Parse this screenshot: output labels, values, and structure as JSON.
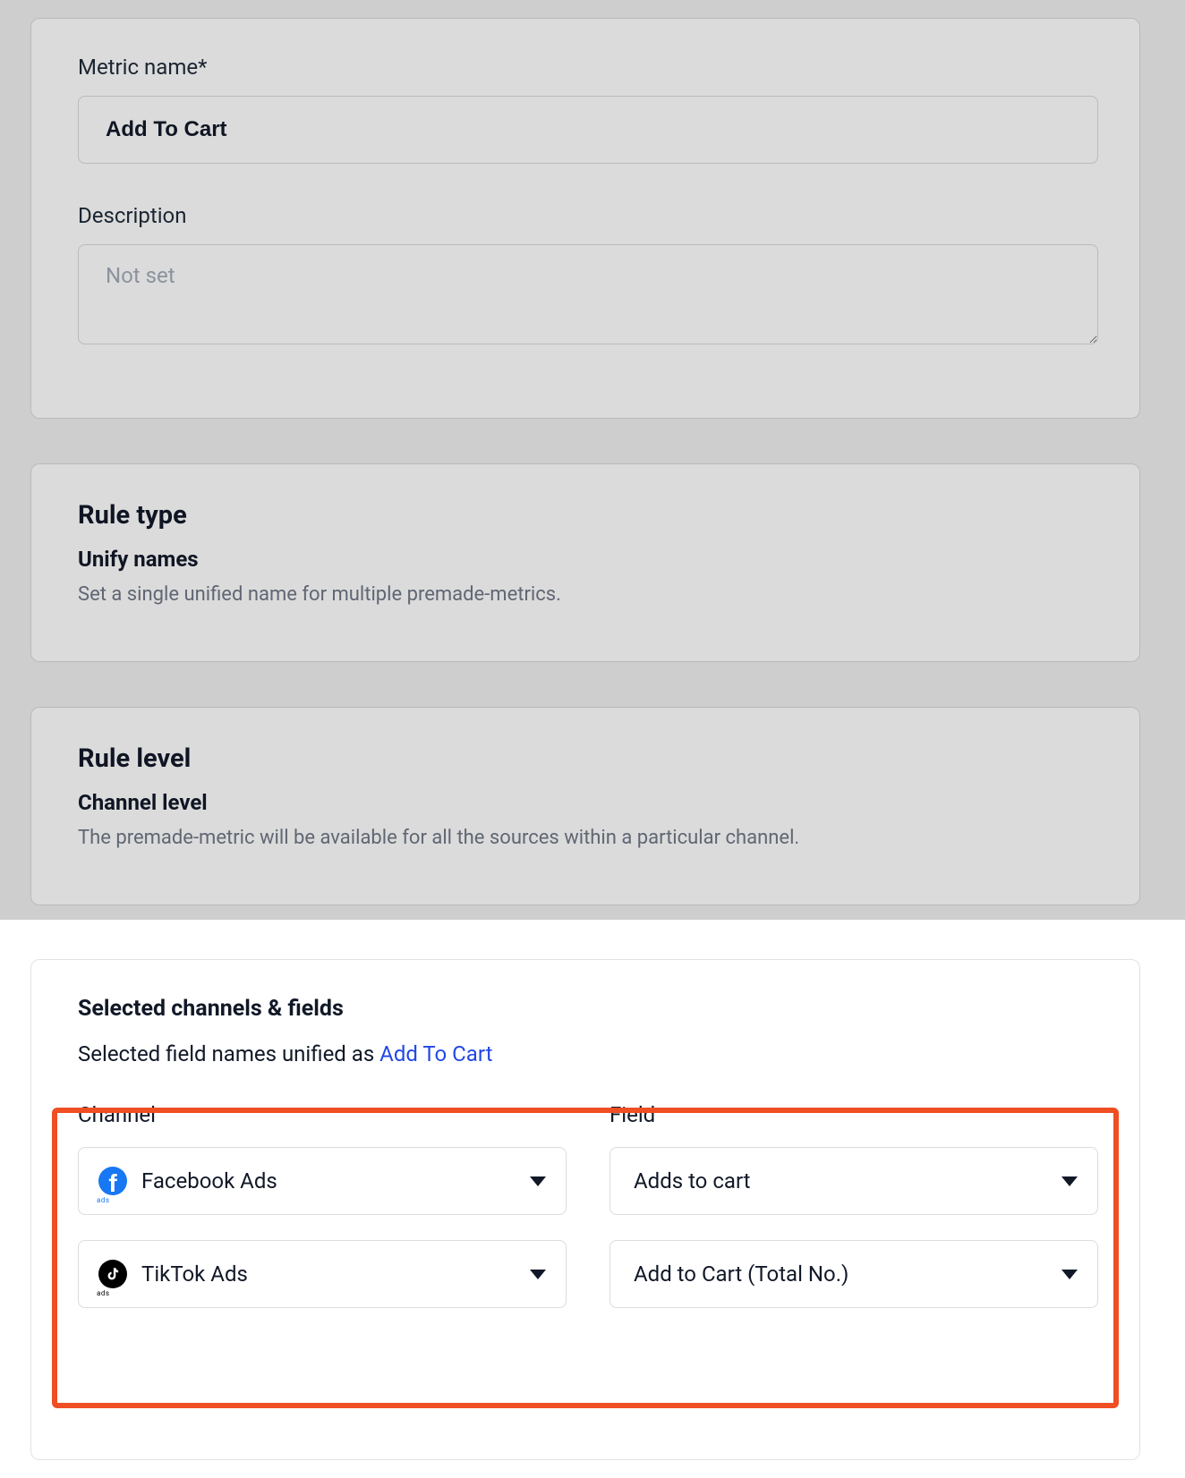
{
  "metric": {
    "name_label": "Metric name*",
    "name_value": "Add To Cart",
    "description_label": "Description",
    "description_placeholder": "Not set",
    "description_value": ""
  },
  "rule_type": {
    "heading": "Rule type",
    "subheading": "Unify names",
    "description": "Set a single unified name for multiple premade-metrics."
  },
  "rule_level": {
    "heading": "Rule level",
    "subheading": "Channel level",
    "description": "The premade-metric will be available for all the sources within a particular channel."
  },
  "selected": {
    "heading": "Selected channels & fields",
    "subtext_prefix": "Selected field names unified as ",
    "unified_name": "Add To Cart",
    "channel_header": "Channel",
    "field_header": "Field",
    "rows": [
      {
        "channel_icon": "facebook-ads-icon",
        "channel_label": "Facebook Ads",
        "field_label": "Adds to cart"
      },
      {
        "channel_icon": "tiktok-ads-icon",
        "channel_label": "TikTok Ads",
        "field_label": "Add to Cart (Total No.)"
      }
    ]
  }
}
